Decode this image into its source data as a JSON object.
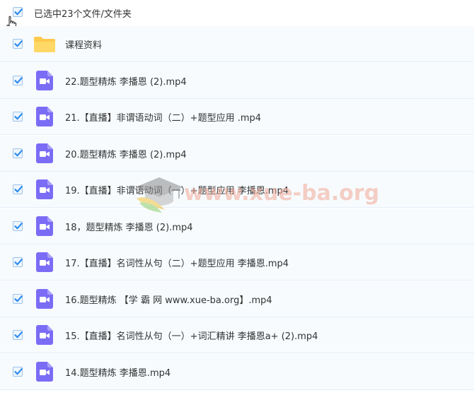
{
  "header": {
    "selection_text": "已选中23个文件/文件夹",
    "select_all_checked": true
  },
  "rows": [
    {
      "name": "课程资料",
      "type": "folder",
      "checked": true
    },
    {
      "name": "22.题型精炼 李播恩 (2).mp4",
      "type": "video",
      "checked": true
    },
    {
      "name": "21.【直播】非谓语动词（二）+题型应用 .mp4",
      "type": "video",
      "checked": true
    },
    {
      "name": "20.题型精炼 李播恩 (2).mp4",
      "type": "video",
      "checked": true
    },
    {
      "name": "19.【直播】非谓语动词（一）+题型应用 李播恩.mp4",
      "type": "video",
      "checked": true
    },
    {
      "name": "18，题型精炼 李播恩 (2).mp4",
      "type": "video",
      "checked": true
    },
    {
      "name": "17.【直播】名词性从句（二）+题型应用 李播恩.mp4",
      "type": "video",
      "checked": true
    },
    {
      "name": "16.题型精炼 【学 霸 网 www.xue-ba.org】.mp4",
      "type": "video",
      "checked": true
    },
    {
      "name": "15.【直播】名词性从句（一）+词汇精讲 李播恩a+ (2).mp4",
      "type": "video",
      "checked": true
    },
    {
      "name": "14.题型精炼 李播恩.mp4",
      "type": "video",
      "checked": true
    }
  ],
  "watermark": {
    "text": "www.xue-ba.org"
  },
  "colors": {
    "checkbox_check": "#2d8cf0",
    "video_icon": "#7b6cf6",
    "folder_icon": "#ffc94d",
    "row_background": "#f7fbfe"
  }
}
